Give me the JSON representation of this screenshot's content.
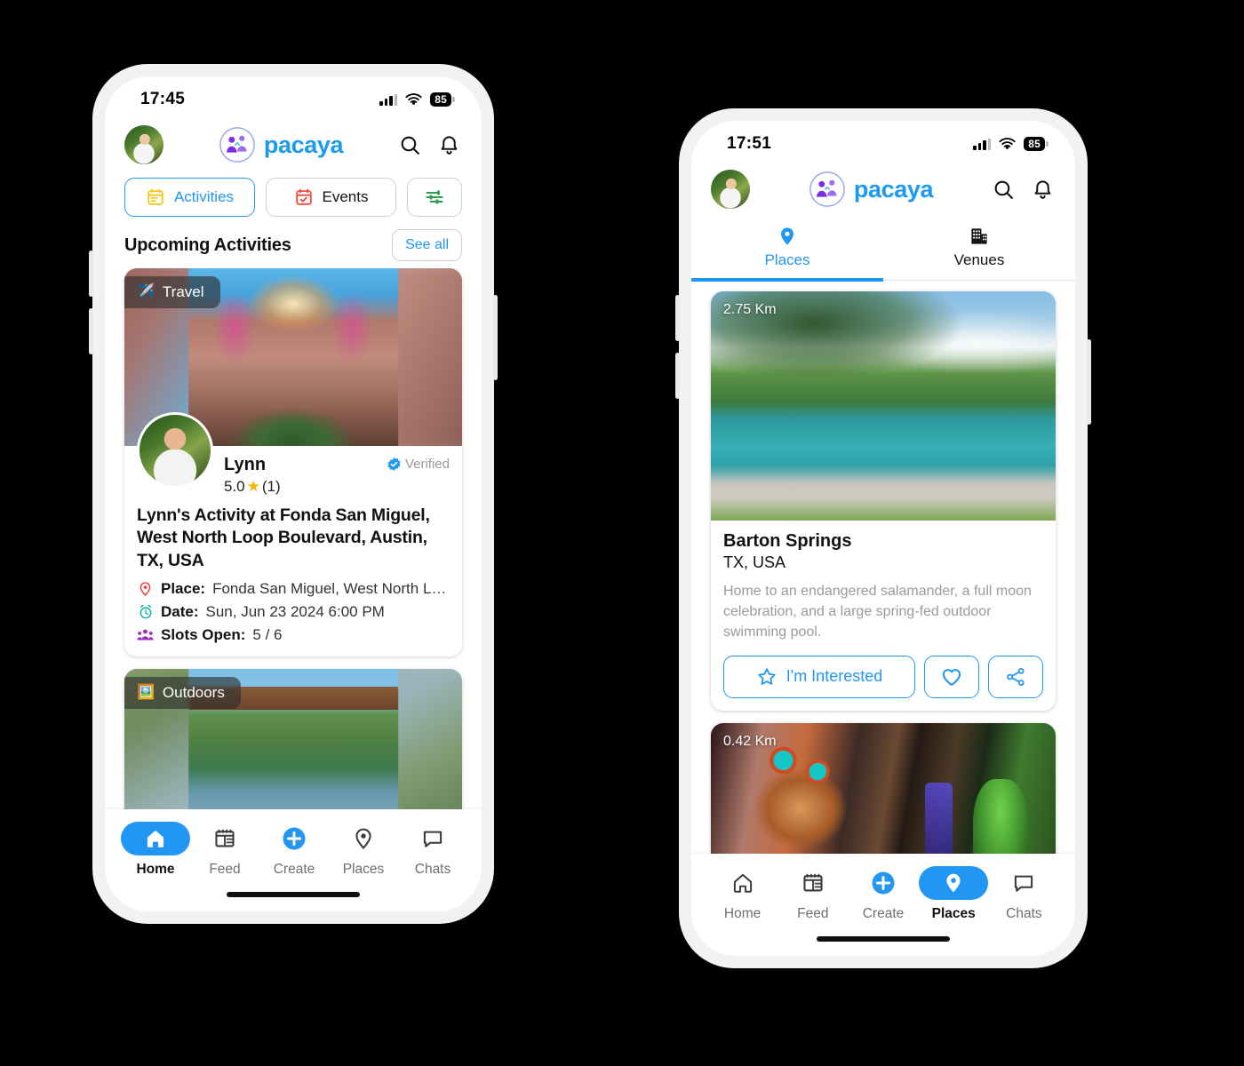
{
  "theme": {
    "accent": "#2196f3",
    "brand_name_color": "#1a9bf0",
    "page_background": "#000000"
  },
  "phone_left": {
    "status": {
      "time": "17:45",
      "battery": "85"
    },
    "header": {
      "brand": "pacaya",
      "avatar_label": "user-avatar",
      "search_label": "Search",
      "notifications_label": "Notifications"
    },
    "filters": [
      {
        "label": "Activities",
        "icon": "calendar-yellow-icon",
        "active": true
      },
      {
        "label": "Events",
        "icon": "calendar-check-red-icon",
        "active": false
      },
      {
        "label": "",
        "icon": "sliders-green-icon",
        "active": false
      }
    ],
    "section": {
      "title": "Upcoming Activities",
      "see_all": "See all"
    },
    "cards": [
      {
        "badge": "Travel",
        "badge_emoji": "✈️",
        "poster_name": "Lynn",
        "rating": "5.0",
        "rating_count": "(1)",
        "verified": "Verified",
        "title": "Lynn's Activity at Fonda San Miguel, West North Loop Boulevard, Austin, TX, USA",
        "meta": [
          {
            "label": "Place:",
            "value": "Fonda San Miguel, West North Loop Boulev…",
            "icon": "location-pin-icon"
          },
          {
            "label": "Date:",
            "value": "Sun, Jun 23 2024 6:00 PM",
            "icon": "alarm-clock-icon"
          },
          {
            "label": "Slots Open:",
            "value": "5 / 6",
            "icon": "people-group-icon"
          }
        ]
      },
      {
        "badge": "Outdoors",
        "badge_emoji": "🖼️",
        "poster_name": "",
        "rating": "",
        "rating_count": "",
        "verified": "",
        "title": "",
        "meta": []
      }
    ],
    "bottom_nav": [
      {
        "label": "Home",
        "icon": "home-icon",
        "active": true
      },
      {
        "label": "Feed",
        "icon": "feed-icon",
        "active": false
      },
      {
        "label": "Create",
        "icon": "plus-circle-icon",
        "active": false
      },
      {
        "label": "Places",
        "icon": "map-pin-icon",
        "active": false
      },
      {
        "label": "Chats",
        "icon": "chat-bubble-icon",
        "active": false
      }
    ]
  },
  "phone_right": {
    "status": {
      "time": "17:51",
      "battery": "85"
    },
    "header": {
      "brand": "pacaya",
      "avatar_label": "user-avatar",
      "search_label": "Search",
      "notifications_label": "Notifications"
    },
    "tabs": [
      {
        "label": "Places",
        "icon": "map-pin-icon",
        "active": true
      },
      {
        "label": "Venues",
        "icon": "building-icon",
        "active": false
      }
    ],
    "places": [
      {
        "distance": "2.75 Km",
        "name": "Barton Springs",
        "location": "TX, USA",
        "description": "Home to an endangered salamander, a full moon celebration, and a large spring-fed outdoor swimming pool.",
        "actions": {
          "interested": "I'm Interested",
          "interested_icon": "star-outline-icon",
          "favorite_icon": "heart-outline-icon",
          "share_icon": "share-icon"
        }
      },
      {
        "distance": "0.42 Km",
        "name": "",
        "location": "",
        "description": "",
        "actions": {
          "interested": "",
          "interested_icon": "",
          "favorite_icon": "",
          "share_icon": ""
        }
      }
    ],
    "bottom_nav": [
      {
        "label": "Home",
        "icon": "home-icon",
        "active": false
      },
      {
        "label": "Feed",
        "icon": "feed-icon",
        "active": false
      },
      {
        "label": "Create",
        "icon": "plus-circle-icon",
        "active": false
      },
      {
        "label": "Places",
        "icon": "map-pin-icon",
        "active": true
      },
      {
        "label": "Chats",
        "icon": "chat-bubble-icon",
        "active": false
      }
    ]
  }
}
